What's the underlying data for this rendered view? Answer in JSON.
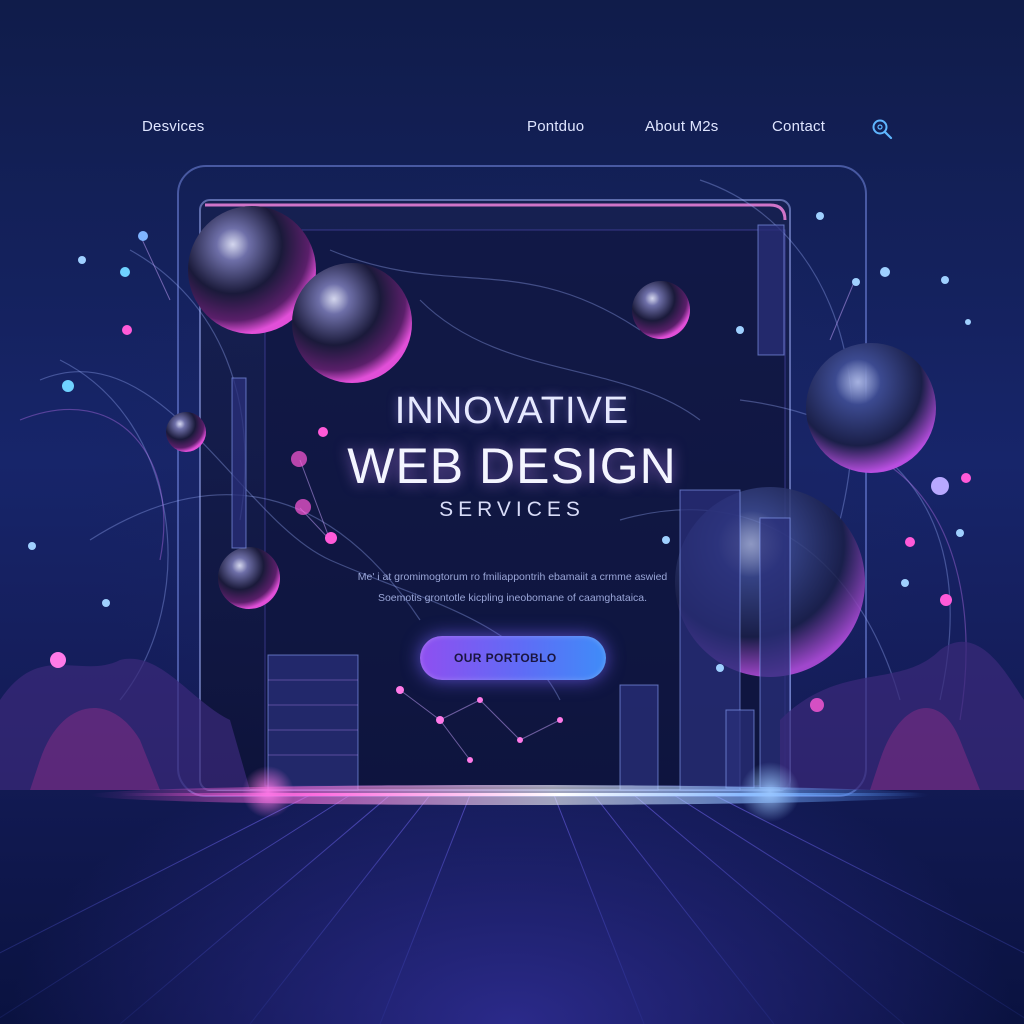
{
  "nav": {
    "services_label": "Desvices",
    "portfolio_label": "Pontduo",
    "about_label": "About M2s",
    "contact_label": "Contact",
    "search_icon": "search-icon"
  },
  "hero": {
    "title_line1": "INNOVATIVE",
    "title_line2": "WEB  DESIGN",
    "subtitle": "SERVICES",
    "description_line1": "Me' i at gromimogtorum ro fmiliappontrih ebamaiit a crmme aswied",
    "description_line2": "Soemotis grontotle kicpling ineobomane of caamghataica.",
    "cta_label": "OUR PORTOBLO"
  },
  "colors": {
    "background": "#141c58",
    "accent_pink": "#e040c8",
    "accent_blue": "#4a8cf8",
    "accent_purple": "#8f4ff0"
  }
}
